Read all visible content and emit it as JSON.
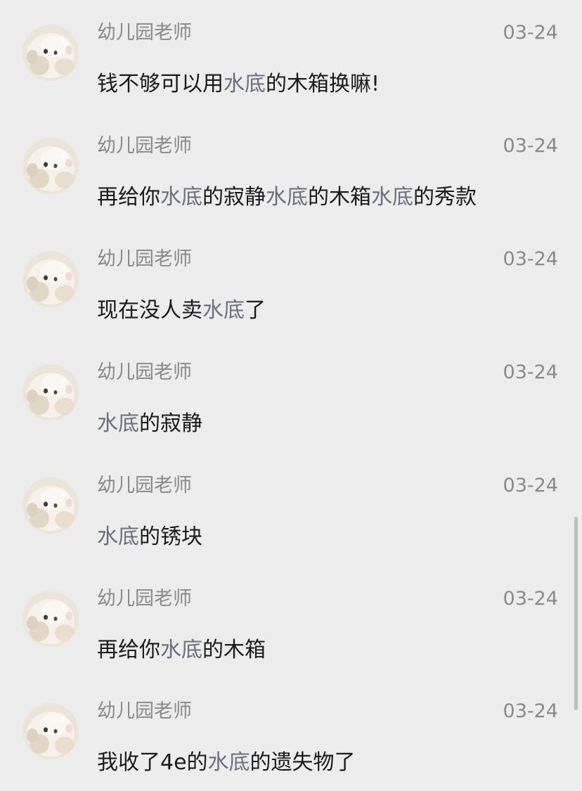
{
  "messages": [
    {
      "sender": "幼儿园老师",
      "time": "03-24",
      "segments": [
        {
          "t": "钱不够可以用",
          "hl": false
        },
        {
          "t": "水底",
          "hl": true
        },
        {
          "t": "的木箱换嘛!",
          "hl": false
        }
      ]
    },
    {
      "sender": "幼儿园老师",
      "time": "03-24",
      "segments": [
        {
          "t": "再给你",
          "hl": false
        },
        {
          "t": "水底",
          "hl": true
        },
        {
          "t": "的寂静",
          "hl": false
        },
        {
          "t": "水底",
          "hl": true
        },
        {
          "t": "的木箱",
          "hl": false
        },
        {
          "t": "水底",
          "hl": true
        },
        {
          "t": "的秀款",
          "hl": false
        }
      ]
    },
    {
      "sender": "幼儿园老师",
      "time": "03-24",
      "segments": [
        {
          "t": "现在没人卖",
          "hl": false
        },
        {
          "t": "水底",
          "hl": true
        },
        {
          "t": "了",
          "hl": false
        }
      ]
    },
    {
      "sender": "幼儿园老师",
      "time": "03-24",
      "segments": [
        {
          "t": "水底",
          "hl": true
        },
        {
          "t": "的寂静",
          "hl": false
        }
      ]
    },
    {
      "sender": "幼儿园老师",
      "time": "03-24",
      "segments": [
        {
          "t": "水底",
          "hl": true
        },
        {
          "t": "的锈块",
          "hl": false
        }
      ]
    },
    {
      "sender": "幼儿园老师",
      "time": "03-24",
      "segments": [
        {
          "t": "再给你",
          "hl": false
        },
        {
          "t": "水底",
          "hl": true
        },
        {
          "t": "的木箱",
          "hl": false
        }
      ]
    },
    {
      "sender": "幼儿园老师",
      "time": "03-24",
      "segments": [
        {
          "t": "我收了4e的",
          "hl": false
        },
        {
          "t": "水底",
          "hl": true
        },
        {
          "t": "的遗失物了",
          "hl": false
        }
      ]
    }
  ],
  "avatar_icon": "cat-avatar-icon",
  "colors": {
    "background": "#ededed",
    "meta_text": "#8a8a8a",
    "message_text": "#1a1a1a",
    "highlight_text": "#6b6f7e"
  }
}
